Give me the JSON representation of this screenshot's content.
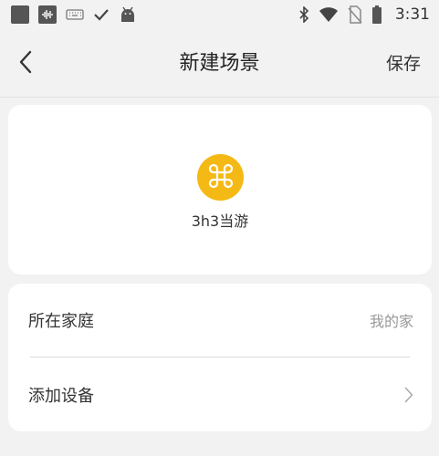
{
  "status_bar": {
    "time": "3:31",
    "left_icons": [
      "square-icon",
      "waveform-icon",
      "keyboard-icon",
      "check-icon",
      "android-icon"
    ],
    "right_icons": [
      "bluetooth-icon",
      "wifi-icon",
      "no-sim-icon",
      "battery-icon"
    ]
  },
  "nav": {
    "title": "新建场景",
    "save_label": "保存",
    "back_icon": "chevron-left-icon"
  },
  "scene": {
    "name": "3h3当游",
    "icon": "command-icon",
    "icon_color": "#f5b915"
  },
  "settings": {
    "family_label": "所在家庭",
    "family_value": "我的家",
    "add_device_label": "添加设备"
  }
}
